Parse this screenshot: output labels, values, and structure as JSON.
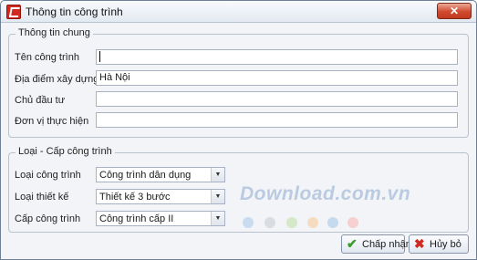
{
  "window": {
    "title": "Thông tin công trình",
    "close_glyph": "✕"
  },
  "general": {
    "legend": "Thông tin chung",
    "fields": [
      {
        "label": "Tên công trình",
        "value": ""
      },
      {
        "label": "Địa điểm xây dựng",
        "value": "Hà Nội"
      },
      {
        "label": "Chủ đầu tư",
        "value": ""
      },
      {
        "label": "Đơn vị thực hiện",
        "value": ""
      }
    ]
  },
  "classification": {
    "legend": "Loại - Cấp công trình",
    "fields": [
      {
        "label": "Loại công trình",
        "value": "Công trình dân dụng"
      },
      {
        "label": "Loại thiết kế",
        "value": "Thiết kế 3 bước"
      },
      {
        "label": "Cấp công trình",
        "value": "Công trình cấp II"
      }
    ],
    "dropdown_glyph": "▼"
  },
  "watermark": {
    "text": "Download.com.vn",
    "dot_colors": [
      "#c9dcef",
      "#d9dce1",
      "#d5e9c8",
      "#f5dcc1",
      "#c5d9ef",
      "#f6cfd0"
    ]
  },
  "buttons": {
    "ok": {
      "label": "Chấp nhận",
      "icon": "check-icon",
      "glyph": "✔",
      "color": "#3a9a2a"
    },
    "cancel": {
      "label": "Hủy bỏ",
      "icon": "x-icon",
      "glyph": "✖",
      "color": "#d2281f"
    }
  }
}
